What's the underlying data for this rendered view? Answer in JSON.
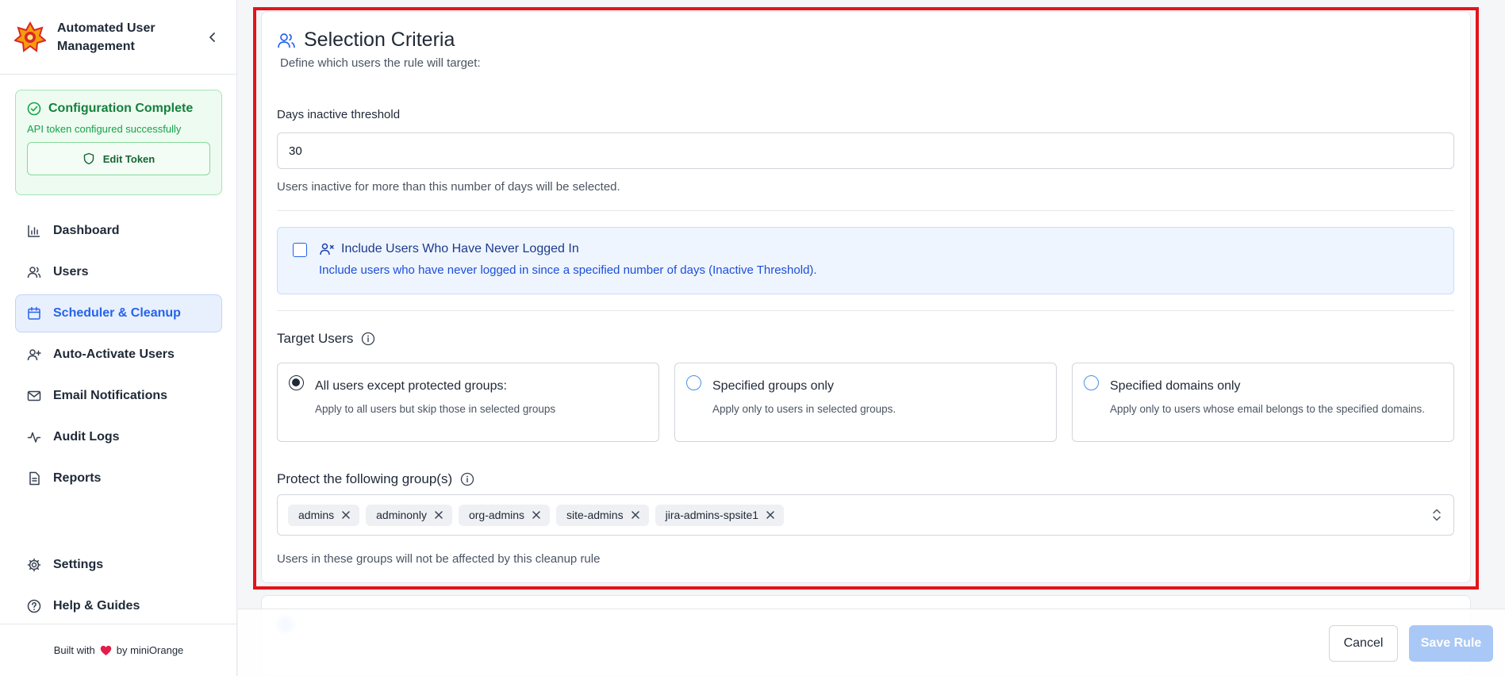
{
  "app": {
    "title": "Automated User Management",
    "collapse_icon": "chevron-left-icon"
  },
  "config": {
    "title": "Configuration Complete",
    "subtitle": "API token configured successfully",
    "edit_label": "Edit Token",
    "accent": "#15803d"
  },
  "nav": {
    "items": [
      {
        "label": "Dashboard",
        "icon": "bar-chart-icon"
      },
      {
        "label": "Users",
        "icon": "users-icon"
      },
      {
        "label": "Scheduler & Cleanup",
        "icon": "calendar-icon",
        "active": true
      },
      {
        "label": "Auto-Activate Users",
        "icon": "user-plus-icon"
      },
      {
        "label": "Email Notifications",
        "icon": "mail-icon"
      },
      {
        "label": "Audit Logs",
        "icon": "activity-icon"
      },
      {
        "label": "Reports",
        "icon": "file-text-icon"
      }
    ],
    "bottom": [
      {
        "label": "Settings",
        "icon": "gear-icon"
      },
      {
        "label": "Help & Guides",
        "icon": "help-circle-icon"
      }
    ]
  },
  "footer": {
    "prefix": "Built with",
    "suffix": "by miniOrange"
  },
  "selection": {
    "title": "Selection Criteria",
    "subtitle": "Define which users the rule will target:",
    "days_label": "Days inactive threshold",
    "days_value": "30",
    "days_help": "Users inactive for more than this number of days will be selected.",
    "never_title": "Include Users Who Have Never Logged In",
    "never_desc": "Include users who have never logged in since a specified number of days (Inactive Threshold).",
    "target_label": "Target Users",
    "options": [
      {
        "title": "All users except protected groups:",
        "desc": "Apply to all users but skip those in selected groups",
        "checked": true
      },
      {
        "title": "Specified groups only",
        "desc": "Apply only to users in selected groups.",
        "checked": false
      },
      {
        "title": "Specified domains only",
        "desc": "Apply only to users whose email belongs to the specified domains.",
        "checked": false
      }
    ],
    "protect_label": "Protect the following group(s)",
    "groups": [
      "admins",
      "adminonly",
      "org-admins",
      "site-admins",
      "jira-admins-spsite1"
    ],
    "protect_help": "Users in these groups will not be affected by this cleanup rule"
  },
  "actions": {
    "cancel": "Cancel",
    "save": "Save Rule"
  }
}
